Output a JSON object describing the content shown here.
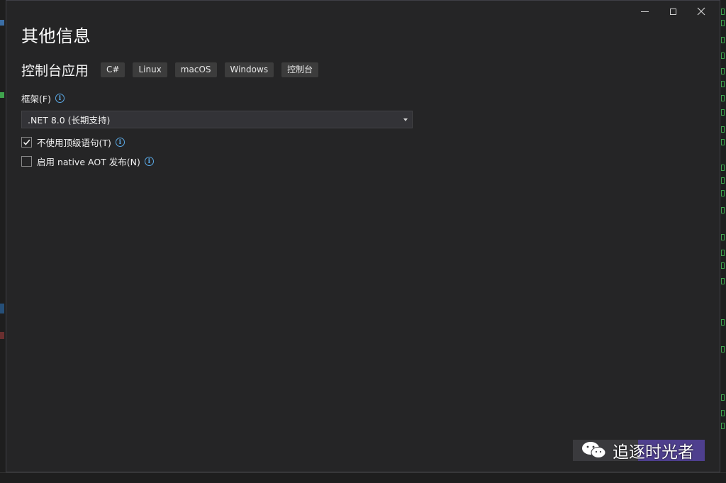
{
  "dialog": {
    "title": "其他信息",
    "template_name": "控制台应用",
    "tags": [
      "C#",
      "Linux",
      "macOS",
      "Windows",
      "控制台"
    ]
  },
  "framework": {
    "label": "框架(F)",
    "selected": ".NET 8.0 (长期支持)"
  },
  "options": {
    "top_level": {
      "label": "不使用顶级语句(T)",
      "checked": true
    },
    "aot": {
      "label": "启用 native AOT 发布(N)",
      "checked": false
    }
  },
  "icons": {
    "minimize": "minimize-icon",
    "maximize": "maximize-icon",
    "close": "close-icon",
    "info": "info-icon",
    "wechat": "wechat-logo"
  },
  "watermark": {
    "text": "追逐时光者"
  },
  "colors": {
    "accent_info": "#5aa9e6",
    "dialog_bg": "#252526",
    "watermark_accent": "#4e3f8e"
  }
}
